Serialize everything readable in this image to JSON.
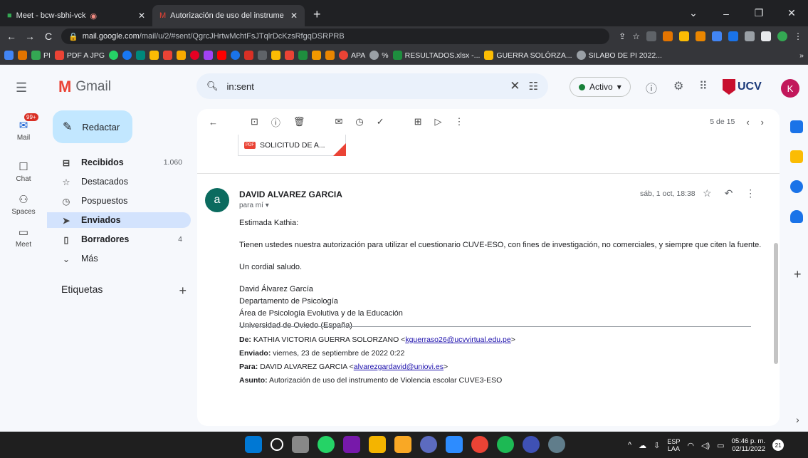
{
  "browser": {
    "tabs": [
      {
        "title": "Meet - bcw-sbhi-vck",
        "active": false
      },
      {
        "title": "Autorización de uso del instrume",
        "active": true
      }
    ],
    "url_host": "mail.google.com",
    "url_path": "/mail/u/2/#sent/QgrcJHrtwMchtFsJTqlrDcKzsRfgqDSRPRB",
    "bookmarks": [
      "PI",
      "PDF A JPG",
      "APA",
      "%",
      "RESULTADOS.xlsx -...",
      "GUERRA SOLÓRZA...",
      "SILABO DE PI 2022..."
    ]
  },
  "gmail": {
    "logo_text": "Gmail",
    "search_value": "in:sent",
    "status_label": "Activo",
    "account_initial": "K",
    "brand": "UCV",
    "compose_label": "Redactar",
    "rail": [
      {
        "label": "Mail",
        "badge": "99+"
      },
      {
        "label": "Chat"
      },
      {
        "label": "Spaces"
      },
      {
        "label": "Meet"
      }
    ],
    "folders": [
      {
        "label": "Recibidos",
        "count": "1.060"
      },
      {
        "label": "Destacados",
        "count": ""
      },
      {
        "label": "Pospuestos",
        "count": ""
      },
      {
        "label": "Enviados",
        "count": ""
      },
      {
        "label": "Borradores",
        "count": "4"
      },
      {
        "label": "Más",
        "count": ""
      }
    ],
    "labels_heading": "Etiquetas",
    "pager": "5 de 15",
    "attachment_name": "SOLICITUD DE A...",
    "message": {
      "sender_initial": "a",
      "sender": "DAVID ALVAREZ GARCIA",
      "to": "para mí",
      "date": "sáb, 1 oct, 18:38",
      "greeting": "Estimada Kathia:",
      "body": "Tienen ustedes nuestra autorización para utilizar el cuestionario CUVE-ESO, con fines de investigación, no comerciales, y siempre que citen la fuente.",
      "closing": "Un cordial saludo.",
      "signature": [
        "David Álvarez García",
        "Departamento de Psicología",
        "Área de Psicología Evolutiva y de la Educación",
        "Universidad de Oviedo (España)"
      ],
      "quoted": {
        "from_label": "De:",
        "from_name": "KATHIA VICTORIA GUERRA SOLORZANO <",
        "from_email": "kguerraso26@ucvvirtual.edu.pe",
        "sent_label": "Enviado:",
        "sent_value": "viernes, 23 de septiembre de 2022 0:22",
        "to_label": "Para:",
        "to_name": "DAVID ALVAREZ GARCIA <",
        "to_email": "alvarezgardavid@uniovi.es",
        "subject_label": "Asunto:",
        "subject_value": "Autorización de uso del instrumento de Violencia escolar CUVE3-ESO"
      }
    }
  },
  "taskbar": {
    "lang_top": "ESP",
    "lang_bottom": "LAA",
    "time": "05:46 p. m.",
    "date": "02/11/2022",
    "notifications": "21"
  },
  "colors": {
    "accent": "#0b57d0",
    "compose_bg": "#c2e7ff",
    "active_folder": "#d3e3fd",
    "badge": "#d93025"
  }
}
